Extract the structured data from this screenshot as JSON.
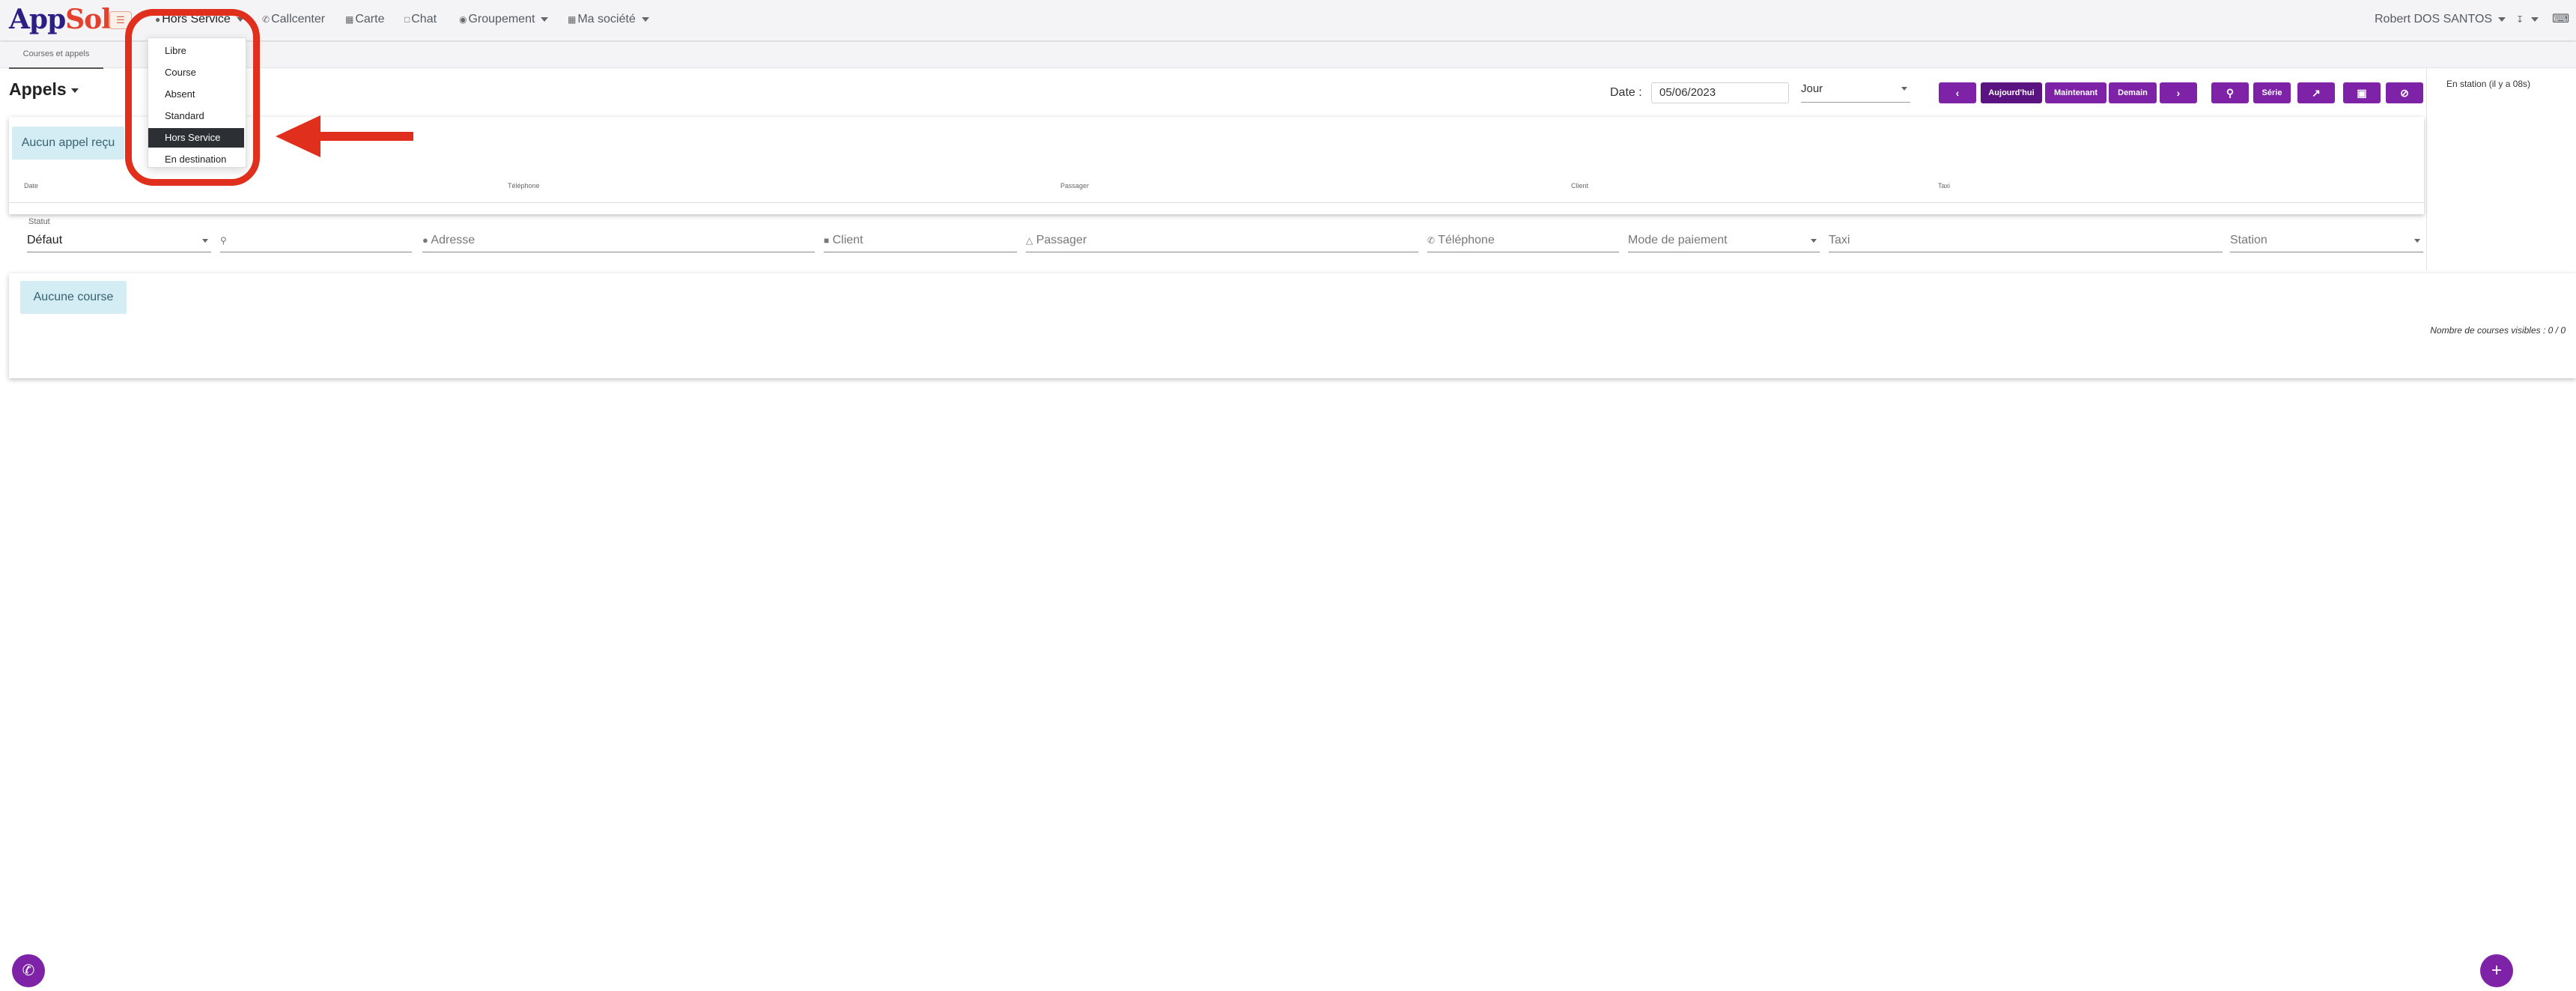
{
  "nav": {
    "logo_part1": "App",
    "logo_part2": "Solu",
    "status_label": "Hors Service",
    "callcenter_label": "Callcenter",
    "carte_label": "Carte",
    "chat_label": "Chat",
    "groupement_label": "Groupement",
    "societe_label": "Ma société",
    "user_name": "Robert DOS SANTOS"
  },
  "tabs": [
    {
      "label": "Courses et appels"
    }
  ],
  "appels": {
    "title": "Appels",
    "date_label": "Date :",
    "date_value": "05/06/2023",
    "period_value": "Jour",
    "btn_today": "Aujourd'hui",
    "btn_now": "Maintenant",
    "btn_tomorrow": "Demain",
    "btn_serie": "Série",
    "empty_message": "Aucun appel reçu",
    "columns": [
      "Date",
      "Téléphone",
      "Passager",
      "Client",
      "Taxi"
    ]
  },
  "right_panel": {
    "station_status": "En station (il y a 08s)"
  },
  "filters": {
    "statut_label": "Statut",
    "statut_value": "Défaut",
    "adresse_placeholder": "Adresse",
    "client_placeholder": "Client",
    "passager_placeholder": "Passager",
    "telephone_placeholder": "Téléphone",
    "paiement_placeholder": "Mode de paiement",
    "taxi_placeholder": "Taxi",
    "station_placeholder": "Station"
  },
  "courses": {
    "empty_message": "Aucune course",
    "visible_count": "Nombre de courses visibles : 0 / 0"
  },
  "status_menu": {
    "items": [
      "Libre",
      "Course",
      "Absent",
      "Standard",
      "Hors Service",
      "En destination"
    ],
    "selected": "Hors Service"
  },
  "colors": {
    "accent": "#7e22a8",
    "accent_dark": "#5a1380",
    "highlight": "#e02f1c",
    "alert_bg": "#d4edf4"
  }
}
